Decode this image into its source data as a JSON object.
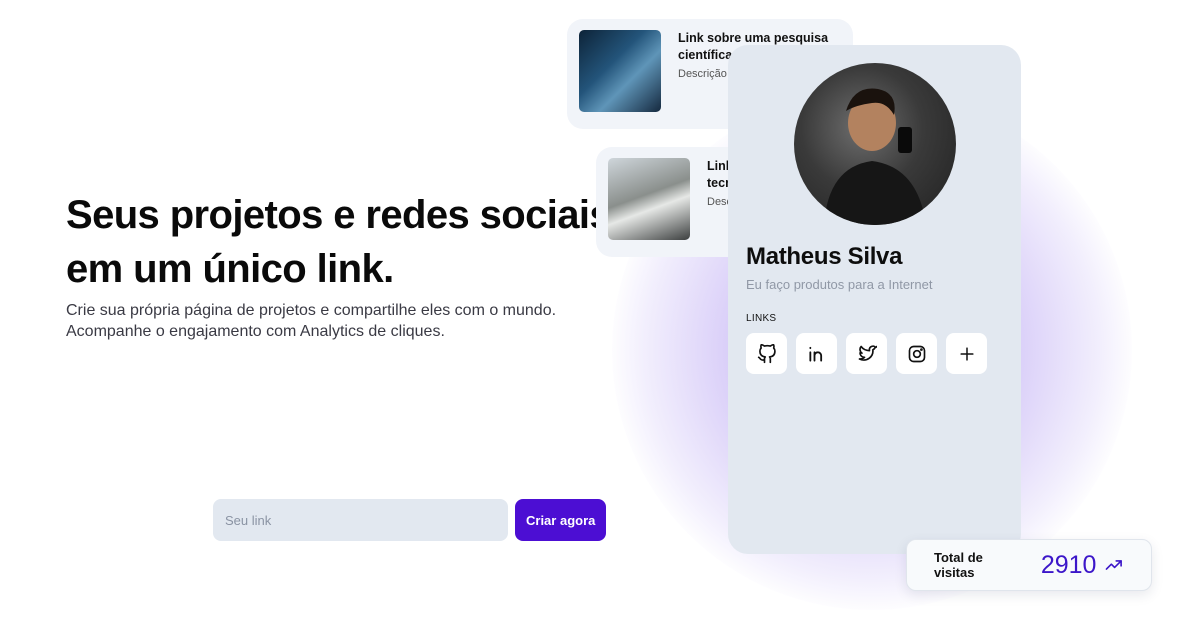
{
  "hero": {
    "title": "Seus projetos e redes sociais em um único link.",
    "subtitle": "Crie sua própria página de projetos e compartilhe eles com o mundo. Acompanhe o engajamento com Analytics de cliques."
  },
  "cta": {
    "input_placeholder": "Seu link",
    "button_label": "Criar agora"
  },
  "link_cards": [
    {
      "title": "Link sobre uma pesquisa científica",
      "description": "Descrição",
      "thumb_icon": "laptop-code-image"
    },
    {
      "title": "Link tecnologia",
      "description": "Descrição",
      "thumb_icon": "laptop-analytics-image"
    }
  ],
  "profile": {
    "name": "Matheus Silva",
    "bio": "Eu faço produtos para a Internet",
    "links_label": "LINKS",
    "social_icons": [
      "github-icon",
      "linkedin-icon",
      "twitter-icon",
      "instagram-icon",
      "plus-icon"
    ]
  },
  "visits": {
    "label": "Total de visitas",
    "count": "2910",
    "trend_icon": "trending-up-icon"
  },
  "colors": {
    "accent": "#4c0ed3",
    "count": "#3c16c9",
    "card_bg": "#e2e8f0"
  }
}
